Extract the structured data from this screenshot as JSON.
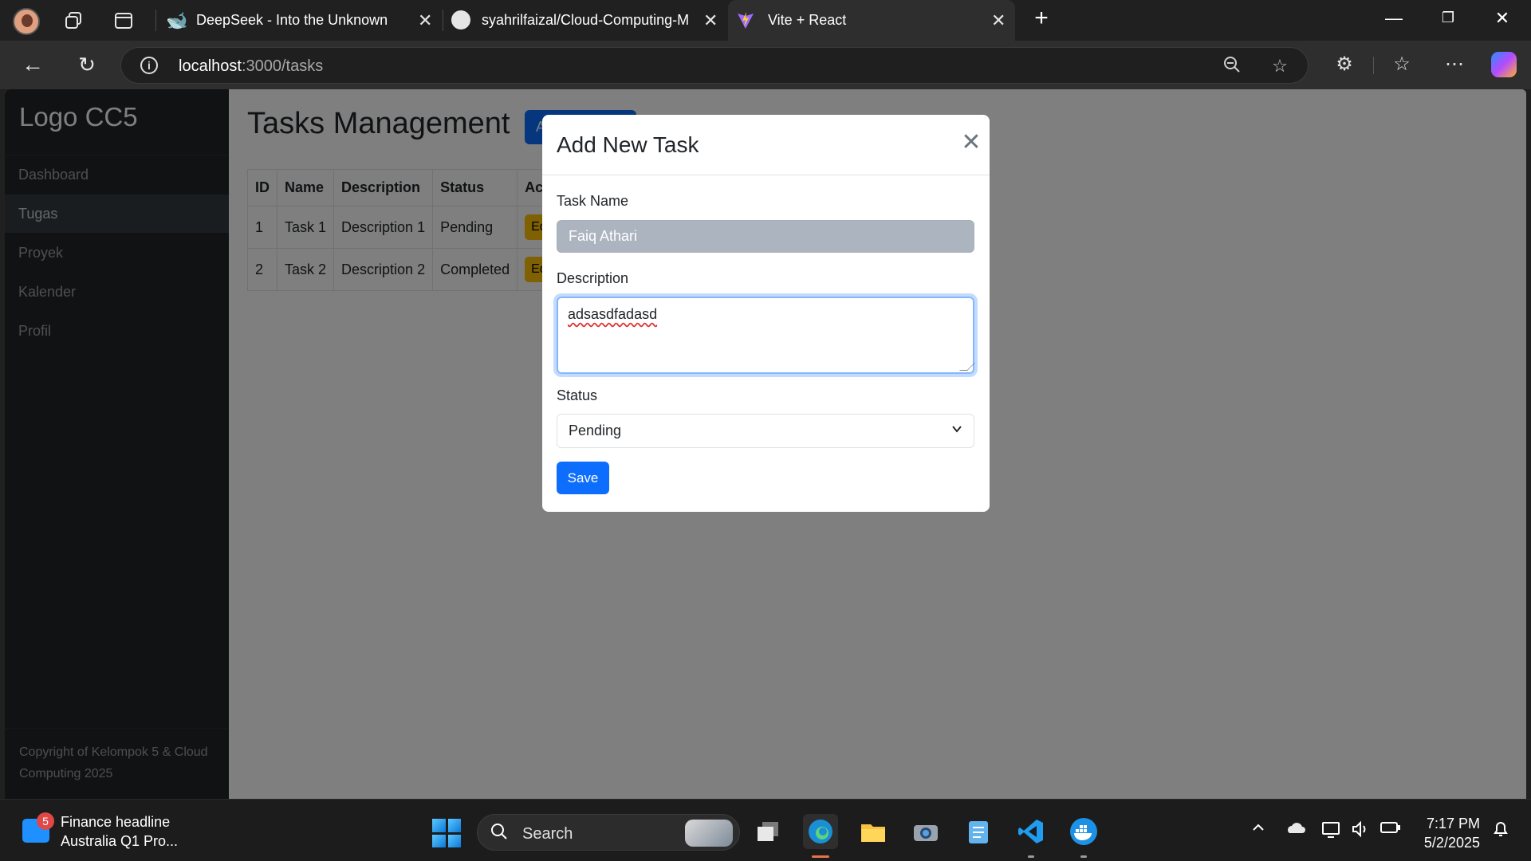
{
  "browser": {
    "tabs": [
      {
        "title": "DeepSeek - Into the Unknown",
        "icon": "deepseek-whale-icon"
      },
      {
        "title": "syahrilfaizal/Cloud-Computing-M",
        "icon": "github-icon"
      },
      {
        "title": "Vite + React",
        "icon": "vite-icon",
        "active": true
      }
    ],
    "url_host": "localhost",
    "url_path": ":3000/tasks"
  },
  "sidebar": {
    "logo": "Logo CC5",
    "items": [
      {
        "label": "Dashboard"
      },
      {
        "label": "Tugas",
        "active": true
      },
      {
        "label": "Proyek"
      },
      {
        "label": "Kalender"
      },
      {
        "label": "Profil"
      }
    ],
    "copyright": "Copyright of Kelompok 5 & Cloud Computing 2025"
  },
  "main": {
    "title": "Tasks Management",
    "add_button": "Add Task",
    "table": {
      "headers": [
        "ID",
        "Name",
        "Description",
        "Status",
        "Actions"
      ],
      "rows": [
        {
          "id": "1",
          "name": "Task 1",
          "description": "Description 1",
          "status": "Pending",
          "edit": "Edit"
        },
        {
          "id": "2",
          "name": "Task 2",
          "description": "Description 2",
          "status": "Completed",
          "edit": "Edit"
        }
      ]
    }
  },
  "modal": {
    "title": "Add New Task",
    "task_name_label": "Task Name",
    "task_name_value": "Faiq Athari",
    "description_label": "Description",
    "description_value": "adsasdfadasd",
    "status_label": "Status",
    "status_value": "Pending",
    "save_label": "Save"
  },
  "taskbar": {
    "news_badge": "5",
    "news_title": "Finance headline",
    "news_subtitle": "Australia Q1 Pro...",
    "search_label": "Search",
    "time": "7:17 PM",
    "date": "5/2/2025"
  },
  "colors": {
    "primary": "#0d6efd",
    "warning": "#ffc107",
    "sidebar_bg": "#212529"
  }
}
